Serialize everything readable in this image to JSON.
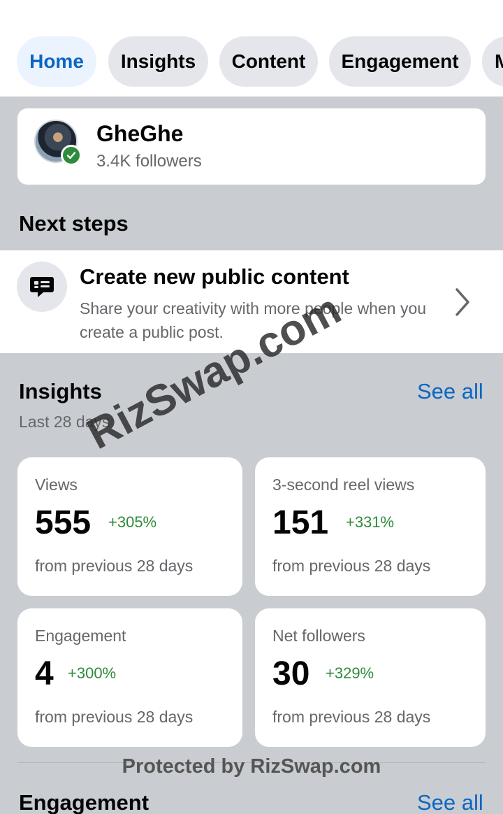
{
  "tabs": [
    {
      "label": "Home",
      "active": true
    },
    {
      "label": "Insights",
      "active": false
    },
    {
      "label": "Content",
      "active": false
    },
    {
      "label": "Engagement",
      "active": false
    },
    {
      "label": "M",
      "active": false
    }
  ],
  "profile": {
    "name": "GheGhe",
    "followers": "3.4K followers",
    "verified": true
  },
  "next_steps": {
    "title": "Next steps",
    "item": {
      "icon": "comment-post-icon",
      "title": "Create new public content",
      "description": "Share your creativity with more people when you create a public post."
    }
  },
  "insights": {
    "title": "Insights",
    "see_all": "See all",
    "period": "Last 28 days",
    "cards": [
      {
        "label": "Views",
        "value": "555",
        "change": "+305%",
        "sub": "from previous 28 days"
      },
      {
        "label": "3-second reel views",
        "value": "151",
        "change": "+331%",
        "sub": "from previous 28 days"
      },
      {
        "label": "Engagement",
        "value": "4",
        "change": "+300%",
        "sub": "from previous 28 days"
      },
      {
        "label": "Net followers",
        "value": "30",
        "change": "+329%",
        "sub": "from previous 28 days"
      }
    ]
  },
  "engagement": {
    "title": "Engagement",
    "see_all": "See all"
  },
  "watermarks": {
    "diagonal": "RizSwap.com",
    "footer": "Protected by RizSwap.com"
  },
  "colors": {
    "accent": "#0a66c2",
    "positive": "#2e8b3a",
    "background_grey": "#c9ccd1"
  }
}
